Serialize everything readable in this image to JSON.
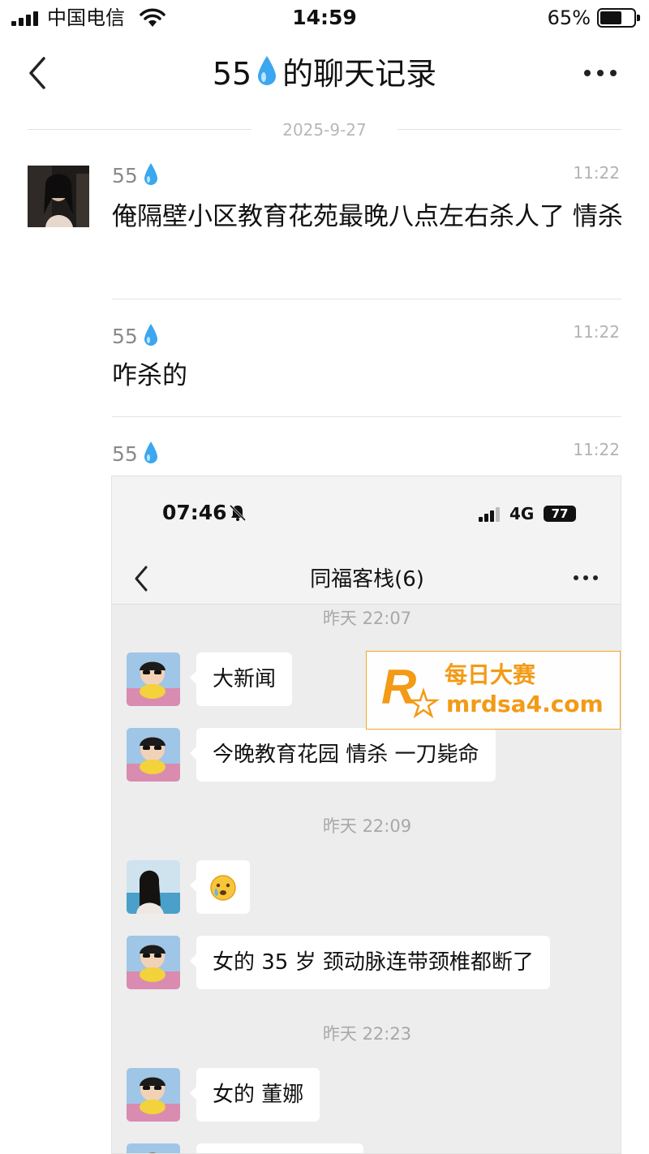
{
  "status_bar": {
    "carrier": "中国电信",
    "time": "14:59",
    "battery_percent": "65%",
    "battery_level": 0.65
  },
  "nav": {
    "title_prefix": "55",
    "title_suffix": "的聊天记录",
    "title_icon": "water-drop-icon"
  },
  "date_separator": "2025-9-27",
  "messages": [
    {
      "sender": "55",
      "time": "11:22",
      "text": "俺隔壁小区教育花苑最晚八点左右杀人了 情杀"
    },
    {
      "sender": "55",
      "time": "11:22",
      "text": "咋杀的"
    },
    {
      "sender": "55",
      "time": "11:22",
      "type": "image"
    }
  ],
  "embedded": {
    "status_time": "07:46",
    "network": "4G",
    "battery": "77",
    "title": "同福客栈(6)",
    "stamps": [
      "昨天 22:07",
      "昨天 22:09",
      "昨天 22:23"
    ],
    "bubbles": [
      "大新闻",
      "今晚教育花园 情杀 一刀毙命",
      "",
      "女的 35 岁 颈动脉连带颈椎都断了",
      "女的 董娜"
    ]
  },
  "watermark": {
    "name": "每日大赛",
    "url": "mrdsa4.com"
  },
  "colors": {
    "accent_drop": "#3aa7f0",
    "watermark_orange": "#f39a16",
    "timestamp_gray": "#b3b3b3"
  }
}
